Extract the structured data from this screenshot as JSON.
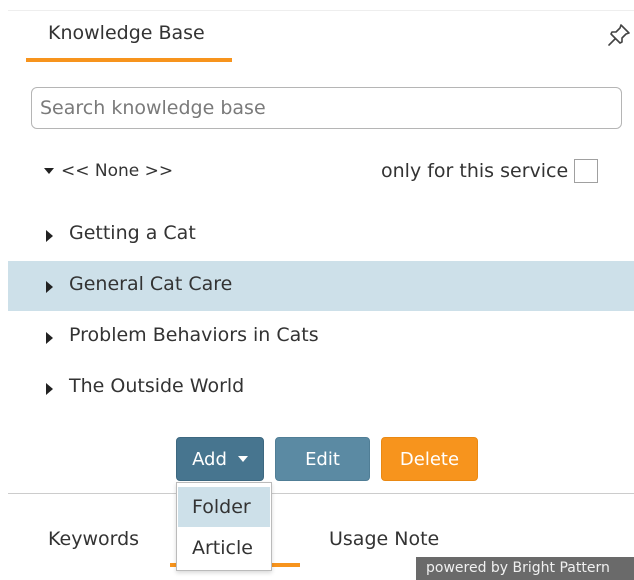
{
  "panel": {
    "tab_label": "Knowledge Base",
    "pin_icon": "pin-icon",
    "accent_color": "#f7941d"
  },
  "search": {
    "placeholder": "Search knowledge base",
    "value": ""
  },
  "filter": {
    "folder_selector": "<< None >>",
    "only_service_label": "only for this service",
    "only_service_checked": false
  },
  "tree": {
    "items": [
      {
        "label": "Getting a Cat",
        "selected": false
      },
      {
        "label": "General Cat Care",
        "selected": true
      },
      {
        "label": "Problem Behaviors in Cats",
        "selected": false
      },
      {
        "label": "The Outside World",
        "selected": false
      }
    ],
    "selected_color": "#cde0e9"
  },
  "actions": {
    "add_label": "Add",
    "edit_label": "Edit",
    "delete_label": "Delete",
    "add_color": "#47758f",
    "edit_color": "#5b8aa3",
    "delete_color": "#f7941d"
  },
  "add_menu": {
    "options": [
      "Folder",
      "Article"
    ],
    "highlighted": "Folder"
  },
  "bottom_tabs": {
    "tabs": [
      "Keywords",
      "Usage Note"
    ]
  },
  "footer": {
    "powered_by": "powered by Bright Pattern"
  }
}
